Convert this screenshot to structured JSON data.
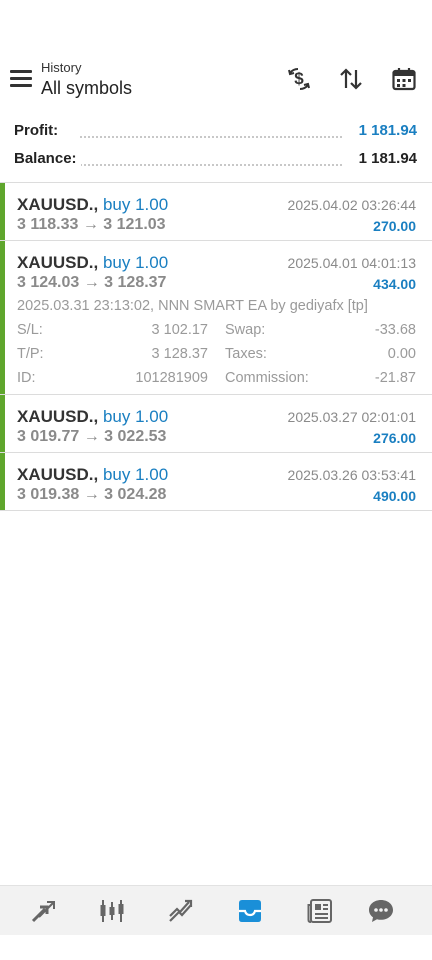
{
  "header": {
    "subtitle": "History",
    "title": "All symbols"
  },
  "summary": {
    "profit_label": "Profit:",
    "profit_value": "1 181.94",
    "balance_label": "Balance:",
    "balance_value": "1 181.94"
  },
  "trades": [
    {
      "symbol": "XAUUSD.,",
      "side": "buy 1.00",
      "prices": "3 118.33 → 3 121.03",
      "time": "2025.04.02 03:26:44",
      "profit": "270.00"
    },
    {
      "symbol": "XAUUSD.,",
      "side": "buy 1.00",
      "prices": "3 124.03 → 3 128.37",
      "time": "2025.04.01 04:01:13",
      "profit": "434.00",
      "details": {
        "open_info": "2025.03.31 23:13:02, NNN SMART EA by gediyafx [tp]",
        "sl_label": "S/L:",
        "sl_value": "3 102.17",
        "swap_label": "Swap:",
        "swap_value": "-33.68",
        "tp_label": "T/P:",
        "tp_value": "3 128.37",
        "taxes_label": "Taxes:",
        "taxes_value": "0.00",
        "id_label": "ID:",
        "id_value": "101281909",
        "commission_label": "Commission:",
        "commission_value": "-21.87"
      }
    },
    {
      "symbol": "XAUUSD.,",
      "side": "buy 1.00",
      "prices": "3 019.77 → 3 022.53",
      "time": "2025.03.27 02:01:01",
      "profit": "276.00"
    },
    {
      "symbol": "XAUUSD.,",
      "side": "buy 1.00",
      "prices": "3 019.38 → 3 024.28",
      "time": "2025.03.26 03:53:41",
      "profit": "490.00"
    }
  ],
  "colors": {
    "accent": "#1a7fc1",
    "buy_bar": "#5fa62d",
    "muted": "#8a8a8a"
  },
  "icons": {
    "header": [
      "menu-icon",
      "deposit-icon",
      "sort-icon",
      "calendar-icon"
    ],
    "bottom_nav": [
      "quotes-icon",
      "chart-icon",
      "trade-icon",
      "history-icon",
      "news-icon",
      "messages-icon"
    ]
  }
}
